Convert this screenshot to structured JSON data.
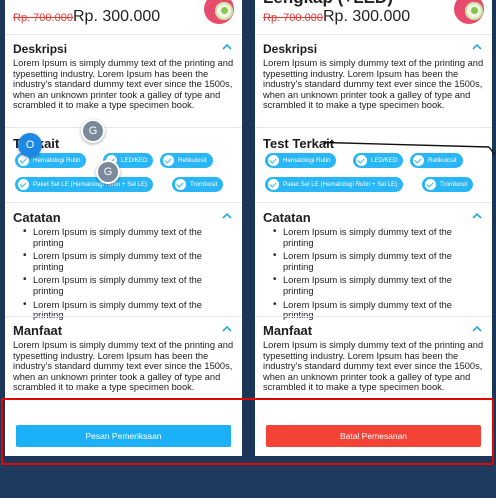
{
  "left_card": {
    "price_old": "Rp. 700.000",
    "price_new": "Rp. 300.000",
    "sections": {
      "deskripsi": {
        "title": "Deskripsi",
        "text": "Lorem Ipsum is simply dummy text of the printing and typesetting industry. Lorem Ipsum has been the industry's standard dummy text ever since the 1500s, when an unknown printer took a galley of type and scrambled it to make a type specimen book."
      },
      "test_terkait": {
        "title_visible": "T      erkait",
        "chips": [
          "Hematologi Rutin",
          "LED/KED",
          "Retikulosit",
          "Paket Sel LE (Hematologi Rutin + Sel LE)",
          "Trombosit"
        ]
      },
      "catatan": {
        "title": "Catatan",
        "items": [
          "Lorem Ipsum is simply dummy text of the printing",
          "Lorem Ipsum is simply dummy text of the printing",
          "Lorem Ipsum is simply dummy text of the printing",
          "Lorem Ipsum is simply dummy text of the printing"
        ]
      },
      "manfaat": {
        "title": "Manfaat",
        "text": "Lorem Ipsum is simply dummy text of the printing and typesetting industry. Lorem Ipsum has been the industry's standard dummy text ever since the 1500s, when an unknown printer took a galley of type and scrambled it to make a type specimen book."
      }
    },
    "button_label": "Pesan Pemeriksaan",
    "overlay_circles": [
      "G",
      "O",
      "G"
    ]
  },
  "right_card": {
    "title_cut": "Lengkap (+LED)",
    "price_old": "Rp. 700.000",
    "price_new": "Rp. 300.000",
    "sections": {
      "deskripsi": {
        "title": "Deskripsi",
        "text": "Lorem Ipsum is simply dummy text of the printing and typesetting industry. Lorem Ipsum has been the industry's standard dummy text ever since the 1500s, when an unknown printer took a galley of type and scrambled it to make a type specimen book."
      },
      "test_terkait": {
        "title": "Test Terkait",
        "chips": [
          "Hematologi Rutin",
          "LED/KED",
          "Retikulosit",
          "Paket Sel LE (Hematologi Rutin + Sel LE)",
          "Trombosit"
        ]
      },
      "catatan": {
        "title": "Catatan",
        "items": [
          "Lorem Ipsum is simply dummy text of the printing",
          "Lorem Ipsum is simply dummy text of the printing",
          "Lorem Ipsum is simply dummy text of the printing",
          "Lorem Ipsum is simply dummy text of the printing"
        ]
      },
      "manfaat": {
        "title": "Manfaat",
        "text": "Lorem Ipsum is simply dummy text of the printing and typesetting industry. Lorem Ipsum has been the industry's standard dummy text ever since the 1500s, when an unknown printer took a galley of type and scrambled it to make a type specimen book."
      }
    },
    "button_label": "Batal Pemesanan"
  },
  "colors": {
    "background": "#1e3a5f",
    "chip_blue": "#29b6f6",
    "primary_button": "#1cb0f6",
    "danger_button": "#f44336",
    "highlight_frame": "#e10600",
    "old_price": "#e53935"
  }
}
